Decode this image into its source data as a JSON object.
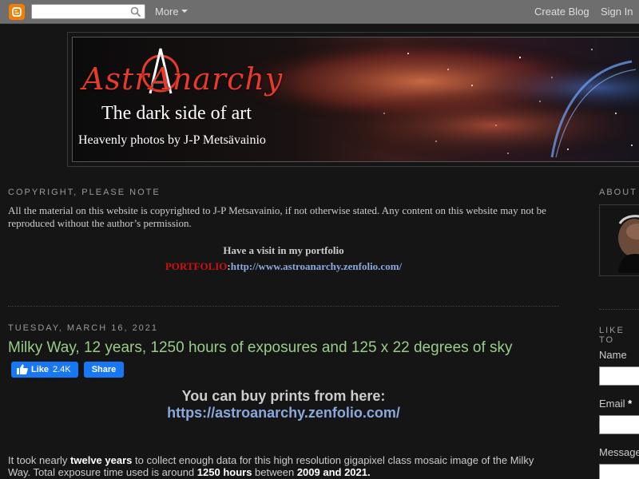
{
  "navbar": {
    "more_label": "More",
    "create_blog_label": "Create Blog",
    "sign_in_label": "Sign In",
    "logo_icon": "blogger-logo-icon",
    "search_icon": "search-icon"
  },
  "header": {
    "title": "AstrAnarchy",
    "tagline": "The dark side of art",
    "subtitle": "Heavenly photos by J-P Metsävainio"
  },
  "copyright": {
    "heading": "COPYRIGHT, PLEASE NOTE",
    "text": "All the material on this website is copyrighted to J-P Metsavainio, if not otherwise stated. Any content on this website may not be reproduced without the author’s permission.",
    "portfolio_heading": "Have a visit in my portfolio",
    "portfolio_label": "PORTFOLIO",
    "portfolio_sep": ":",
    "portfolio_url": "http://www.astroanarchy.zenfolio.com/"
  },
  "post": {
    "date": "TUESDAY, MARCH 16, 2021",
    "title": "Milky Way, 12 years, 1250 hours of exposures and 125 x 22 degrees of sky",
    "fb_like_label": "Like",
    "fb_like_count": "2.4K",
    "fb_share_label": "Share",
    "buy_text": "You can buy prints from here:",
    "buy_url": "https://astroanarchy.zenfolio.com/",
    "body": {
      "p1": "It took nearly ",
      "b1": "twelve years",
      "p2": " to collect enough data for this high resolution gigapixel class mosaic image of the Milky Way.  Total exposure time used is around ",
      "b2": "1250 hours",
      "p3": " between ",
      "b3": "2009 and 2021."
    }
  },
  "sidebar": {
    "about_heading": "ABOUT",
    "like_heading": "LIKE TO",
    "name_label": "Name",
    "email_label": "Email",
    "email_required": "*",
    "message_label": "Message"
  },
  "colors": {
    "background": "#151515",
    "navbar": "#6e6e6e",
    "post_title": "#99cc88",
    "link": "#8aa8dd",
    "portfolio_label": "#cc1111",
    "facebook": "#1877f2",
    "blogger": "#f57d00"
  }
}
